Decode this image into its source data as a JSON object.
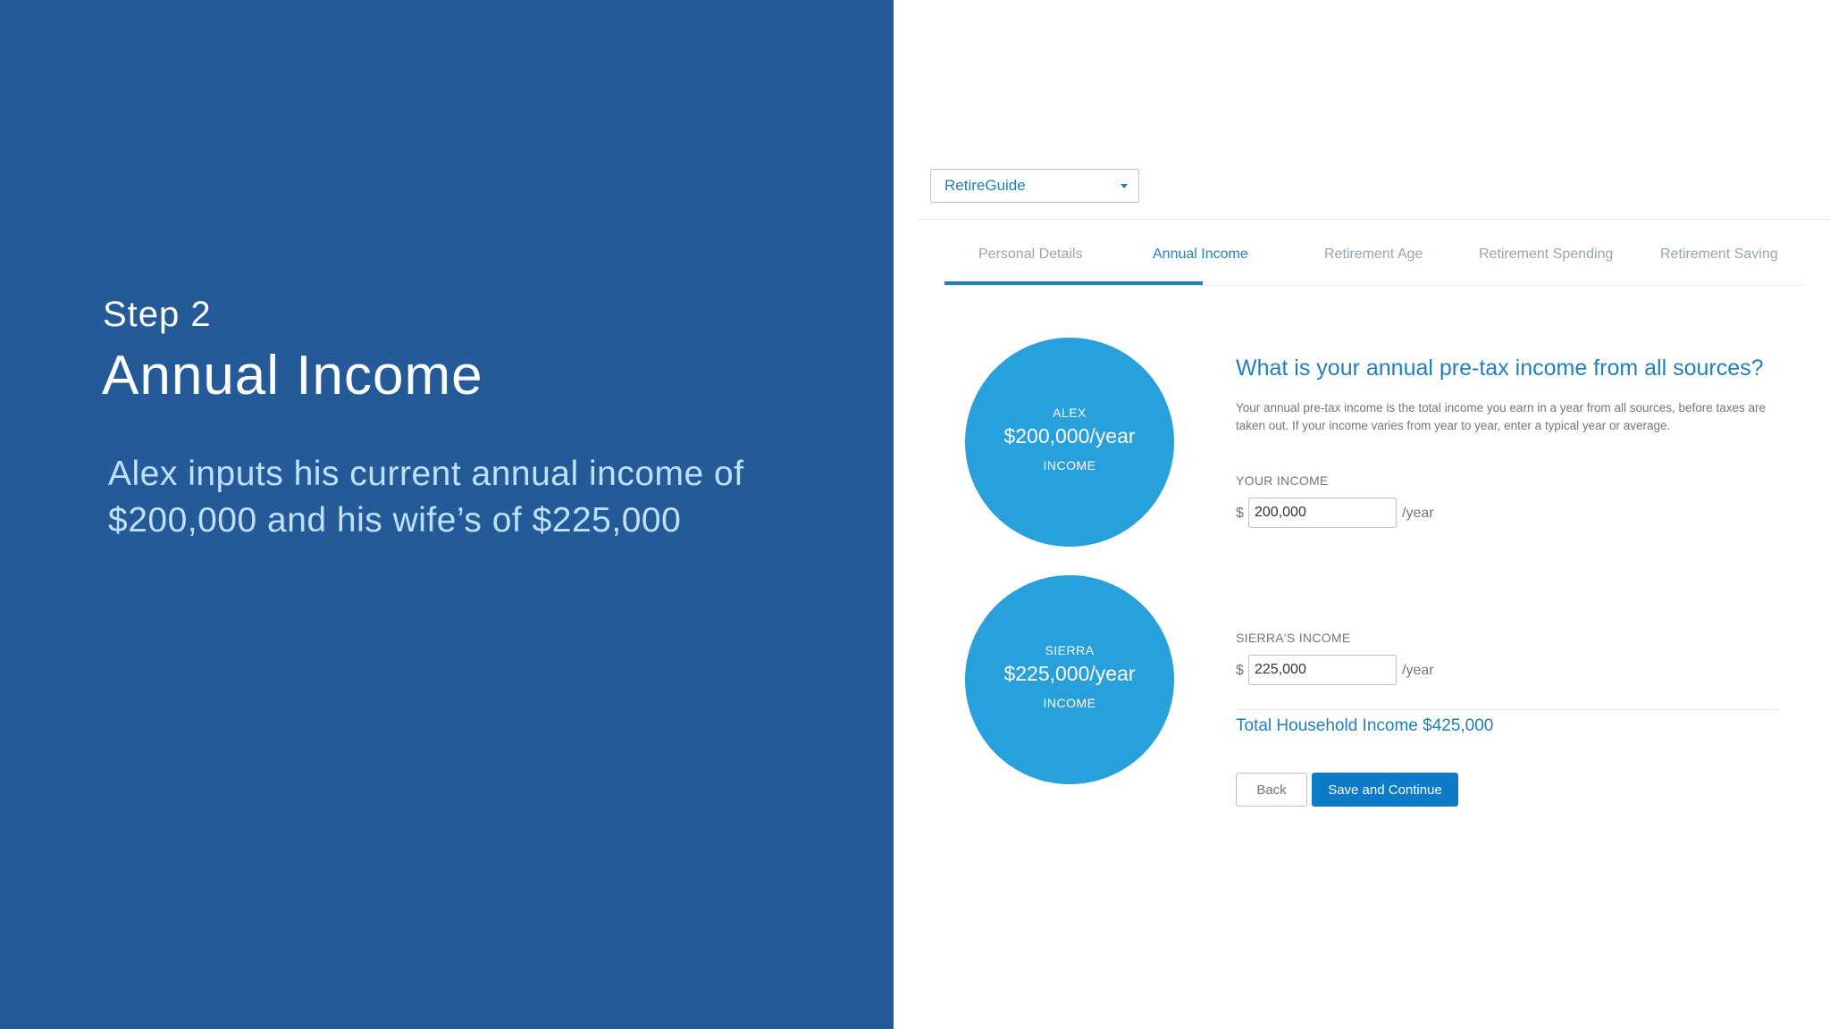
{
  "intro": {
    "step": "Step 2",
    "title": "Annual Income",
    "description": "Alex inputs his current annual income of $200,000 and his wife’s of $225,000"
  },
  "app": {
    "selector": {
      "value": "RetireGuide"
    },
    "tabs": [
      {
        "label": "Personal Details",
        "active": false
      },
      {
        "label": "Annual Income",
        "active": true
      },
      {
        "label": "Retirement Age",
        "active": false
      },
      {
        "label": "Retirement Spending",
        "active": false
      },
      {
        "label": "Retirement Saving",
        "active": false
      }
    ],
    "circles": [
      {
        "name": "ALEX",
        "amount": "$200,000/year",
        "sub": "INCOME"
      },
      {
        "name": "SIERRA",
        "amount": "$225,000/year",
        "sub": "INCOME"
      }
    ],
    "question": "What is your annual pre-tax income from all sources?",
    "help": "Your annual pre-tax income is the total income you earn in a year from all sources, before taxes are taken out. If your income varies from year to year, enter a typical year or average.",
    "fields": [
      {
        "label": "YOUR INCOME",
        "currency": "$",
        "value": "200,000",
        "unit": "/year"
      },
      {
        "label": "SIERRA'S INCOME",
        "currency": "$",
        "value": "225,000",
        "unit": "/year"
      }
    ],
    "total": "Total Household Income $425,000",
    "buttons": {
      "back": "Back",
      "save": "Save and Continue"
    },
    "colors": {
      "panel": "#245a97",
      "accent": "#1f7fc0",
      "circle": "#27a0dc",
      "primary_button": "#0d7bc8"
    }
  }
}
